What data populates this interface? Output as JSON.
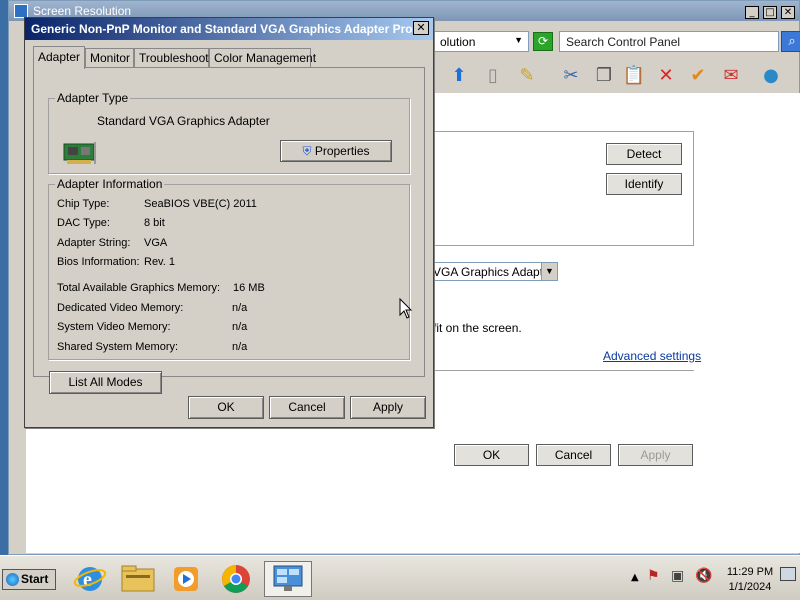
{
  "background_window": {
    "title": "Screen Resolution",
    "address_text": "olution",
    "search_placeholder": "Search Control Panel",
    "detect_label": "Detect",
    "identify_label": "Identify",
    "adapter_select_value": "VGA Graphics Adapter",
    "fit_text": "fit on the screen.",
    "advanced_link": "Advanced settings",
    "ok_label": "OK",
    "cancel_label": "Cancel",
    "apply_label": "Apply"
  },
  "dialog": {
    "title": "Generic Non-PnP Monitor and Standard VGA Graphics Adapter Pro...",
    "tabs": [
      {
        "label": "Adapter"
      },
      {
        "label": "Monitor"
      },
      {
        "label": "Troubleshoot"
      },
      {
        "label": "Color Management"
      }
    ],
    "adapter_type": {
      "legend": "Adapter Type",
      "name": "Standard VGA Graphics Adapter",
      "properties_label": "Properties"
    },
    "adapter_info": {
      "legend": "Adapter Information",
      "rows": [
        {
          "label": "Chip Type:",
          "value": "SeaBIOS VBE(C) 2011"
        },
        {
          "label": "DAC Type:",
          "value": "8 bit"
        },
        {
          "label": "Adapter String:",
          "value": "VGA"
        },
        {
          "label": "Bios Information:",
          "value": "Rev. 1"
        }
      ],
      "memory": [
        {
          "label": "Total Available Graphics Memory:",
          "value": "16 MB"
        },
        {
          "label": "Dedicated Video Memory:",
          "value": "n/a"
        },
        {
          "label": "System Video Memory:",
          "value": "n/a"
        },
        {
          "label": "Shared System Memory:",
          "value": "n/a"
        }
      ]
    },
    "list_all_modes_label": "List All Modes",
    "ok_label": "OK",
    "cancel_label": "Cancel",
    "apply_label": "Apply"
  },
  "taskbar": {
    "start_label": "Start",
    "apps": [
      {
        "icon": "internet-explorer-icon"
      },
      {
        "icon": "file-explorer-icon"
      },
      {
        "icon": "media-player-icon"
      },
      {
        "icon": "chrome-icon"
      },
      {
        "icon": "control-panel-icon",
        "active": true
      }
    ],
    "clock_time": "11:29 PM",
    "clock_date": "1/1/2024"
  }
}
